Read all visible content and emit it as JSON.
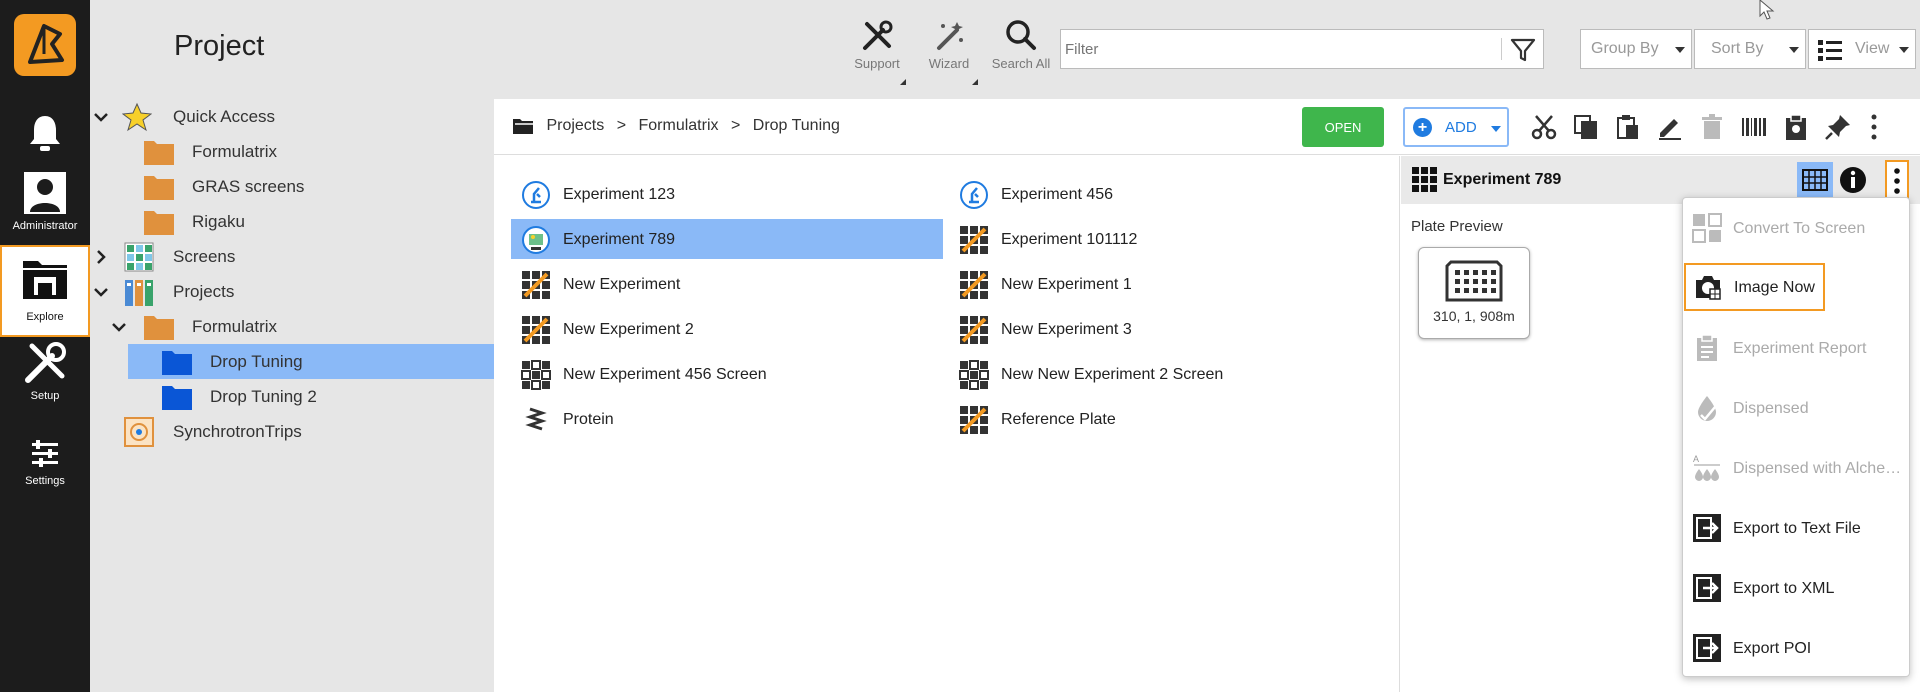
{
  "colors": {
    "accent": "#f39a22",
    "selection": "#8ab9f7",
    "open_button": "#3fb64c",
    "add_blue": "#1f7be0",
    "rail_bg": "#1c1c1c",
    "header_bg": "#e6e6e6"
  },
  "rail": {
    "items": [
      {
        "label": "",
        "icon": "bell-icon"
      },
      {
        "label": "Administrator",
        "icon": "user-icon"
      },
      {
        "label": "Explore",
        "icon": "explore-icon",
        "active": true
      },
      {
        "label": "Setup",
        "icon": "tools-icon"
      },
      {
        "label": "Settings",
        "icon": "sliders-icon"
      }
    ]
  },
  "header": {
    "title": "Project",
    "tools": [
      {
        "label": "Support",
        "icon": "support-icon"
      },
      {
        "label": "Wizard",
        "icon": "wizard-icon"
      },
      {
        "label": "Search All",
        "icon": "search-icon"
      }
    ],
    "filter_placeholder": "Filter",
    "group_by_label": "Group By",
    "sort_by_label": "Sort By",
    "view_label": "View"
  },
  "tree": {
    "items": [
      {
        "label": "Quick Access",
        "icon": "star-icon",
        "expanded": true
      },
      {
        "label": "Formulatrix",
        "icon": "folder-icon"
      },
      {
        "label": "GRAS screens",
        "icon": "folder-icon"
      },
      {
        "label": "Rigaku",
        "icon": "folder-icon"
      },
      {
        "label": "Screens",
        "icon": "screens-icon",
        "expanded": false
      },
      {
        "label": "Projects",
        "icon": "projects-icon",
        "expanded": true
      },
      {
        "label": "Formulatrix",
        "icon": "folder-icon",
        "expanded": true
      },
      {
        "label": "Drop Tuning",
        "icon": "blue-folder-icon",
        "selected": true
      },
      {
        "label": "Drop Tuning 2",
        "icon": "blue-folder-icon"
      },
      {
        "label": "SynchrotronTrips",
        "icon": "synchrotron-icon"
      }
    ]
  },
  "breadcrumb": {
    "items": [
      "Projects",
      "Formulatrix",
      "Drop Tuning"
    ],
    "separator": ">"
  },
  "toolbar": {
    "open_label": "OPEN",
    "add_label": "ADD",
    "icons": [
      "cut-icon",
      "copy-icon",
      "paste-icon",
      "rename-icon",
      "delete-icon",
      "barcode-icon",
      "clipboard-icon",
      "pin-icon",
      "more-icon"
    ]
  },
  "content": {
    "left": [
      {
        "label": "Experiment 123",
        "icon": "microscope-icon"
      },
      {
        "label": "Experiment 789",
        "icon": "image-plate-icon",
        "selected": true
      },
      {
        "label": "New Experiment",
        "icon": "experiment-icon"
      },
      {
        "label": "New Experiment 2",
        "icon": "experiment-icon"
      },
      {
        "label": "New Experiment 456 Screen",
        "icon": "screen-grid-icon"
      },
      {
        "label": "Protein",
        "icon": "protein-icon"
      }
    ],
    "right": [
      {
        "label": "Experiment 456",
        "icon": "microscope-icon"
      },
      {
        "label": "Experiment 101112",
        "icon": "experiment-icon"
      },
      {
        "label": "New Experiment 1",
        "icon": "experiment-icon"
      },
      {
        "label": "New Experiment 3",
        "icon": "experiment-icon"
      },
      {
        "label": "New New Experiment 2 Screen",
        "icon": "screen-grid-icon"
      },
      {
        "label": "Reference Plate",
        "icon": "experiment-icon"
      }
    ]
  },
  "detail": {
    "title": "Experiment 789",
    "preview_label": "Plate Preview",
    "plate_caption": "310, 1, 908m"
  },
  "menu": {
    "items": [
      {
        "label": "Convert To Screen",
        "icon": "convert-icon",
        "enabled": false
      },
      {
        "label": "Image Now",
        "icon": "camera-icon",
        "enabled": true,
        "focused": true
      },
      {
        "label": "Experiment Report",
        "icon": "report-icon",
        "enabled": false
      },
      {
        "label": "Dispensed",
        "icon": "dispense-icon",
        "enabled": false
      },
      {
        "label": "Dispensed with Alchemist",
        "icon": "dispense-alchemist-icon",
        "enabled": false
      },
      {
        "label": "Export to Text File",
        "icon": "export-icon",
        "enabled": true
      },
      {
        "label": "Export to XML",
        "icon": "export-icon",
        "enabled": true
      },
      {
        "label": "Export POI",
        "icon": "export-icon",
        "enabled": true
      }
    ]
  }
}
